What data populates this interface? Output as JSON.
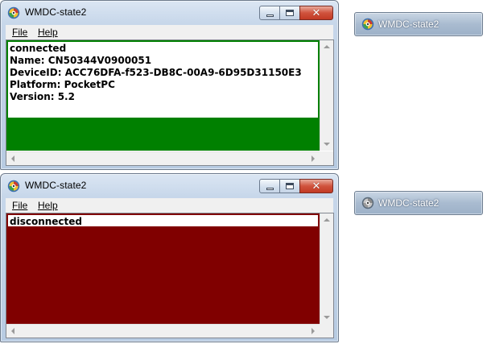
{
  "windows": [
    {
      "title": "WMDC-state2",
      "menu": {
        "file": "File",
        "help": "Help"
      },
      "status_color": "#008000",
      "lines": [
        "connected",
        "Name: CN50344V0900051",
        "DeviceID: ACC76DFA-f523-DB8C-00A9-6D95D31150E3",
        "Platform: PocketPC",
        "Version: 5.2"
      ]
    },
    {
      "title": "WMDC-state2",
      "menu": {
        "file": "File",
        "help": "Help"
      },
      "status_color": "#800000",
      "lines": [
        "disconnected"
      ]
    }
  ],
  "taskbar_buttons": [
    {
      "label": "WMDC-state2",
      "icon": "wmdc-app-icon"
    },
    {
      "label": "WMDC-state2",
      "icon": "wmdc-app-icon"
    }
  ],
  "icons": {
    "app": "wmdc-app-icon",
    "minimize": "minimize-icon",
    "maximize": "maximize-icon",
    "close": "close-icon"
  }
}
